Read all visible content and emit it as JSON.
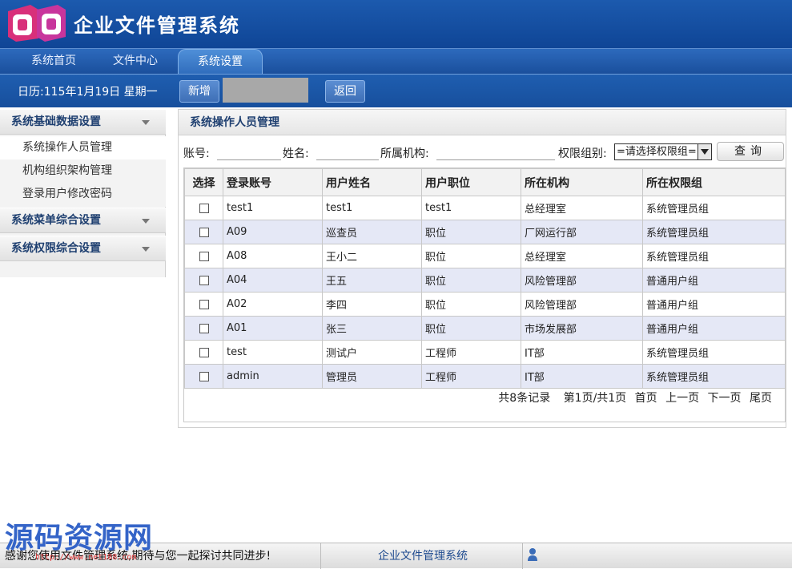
{
  "app": {
    "title": "企业文件管理系统"
  },
  "nav": {
    "tabs": [
      {
        "label": "系统首页"
      },
      {
        "label": "文件中心"
      },
      {
        "label": "系统设置"
      }
    ]
  },
  "toolbar": {
    "date": "日历:115年1月19日 星期一",
    "add_label": "新增",
    "back_label": "返回"
  },
  "sidebar": {
    "group1": "系统基础数据设置",
    "items": [
      "系统操作人员管理",
      "机构组织架构管理",
      "登录用户修改密码"
    ],
    "group2": "系统菜单综合设置",
    "group3": "系统权限综合设置"
  },
  "panel": {
    "title": "系统操作人员管理"
  },
  "filter": {
    "account_label": "账号:",
    "name_label": "姓名:",
    "org_label": "所属机构:",
    "group_label": "权限组别:",
    "group_selected": "=请选择权限组=",
    "query_label": "查询"
  },
  "table": {
    "headers": [
      "选择",
      "登录账号",
      "用户姓名",
      "用户职位",
      "所在机构",
      "所在权限组"
    ],
    "rows": [
      [
        "test1",
        "test1",
        "test1",
        "总经理室",
        "系统管理员组"
      ],
      [
        "A09",
        "巡查员",
        "职位",
        "厂网运行部",
        "系统管理员组"
      ],
      [
        "A08",
        "王小二",
        "职位",
        "总经理室",
        "系统管理员组"
      ],
      [
        "A04",
        "王五",
        "职位",
        "风险管理部",
        "普通用户组"
      ],
      [
        "A02",
        "李四",
        "职位",
        "风险管理部",
        "普通用户组"
      ],
      [
        "A01",
        "张三",
        "职位",
        "市场发展部",
        "普通用户组"
      ],
      [
        "test",
        "测试户",
        "工程师",
        "IT部",
        "系统管理员组"
      ],
      [
        "admin",
        "管理员",
        "工程师",
        "IT部",
        "系统管理员组"
      ]
    ]
  },
  "pager": {
    "total": "共8条记录",
    "page": "第1页/共1页",
    "first": "首页",
    "prev": "上一页",
    "next": "下一页",
    "last": "尾页"
  },
  "watermark": {
    "text": "源码资源网",
    "url": "http://www.net188.com"
  },
  "footer": {
    "message": "感谢您使用文件管理系统,期待与您一起探讨共同进步!",
    "title": "企业文件管理系统"
  },
  "colors": {
    "header_blue": "#1c5aae",
    "row_alt": "#e5e8f6",
    "watermark_blue": "#3464c8",
    "watermark_url_red": "#e23b3b"
  }
}
